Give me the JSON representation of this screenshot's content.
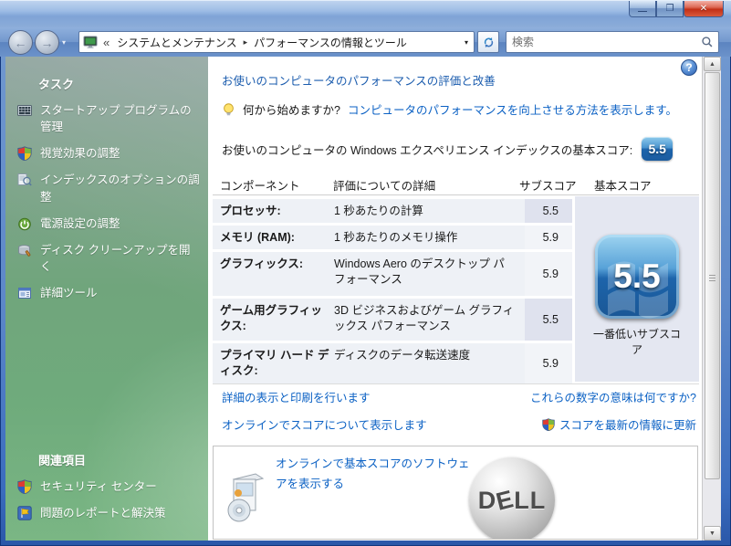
{
  "ui": {
    "glyphs": {
      "minimize": "—",
      "maximize": "❐",
      "close": "✕",
      "back": "←",
      "forward": "→",
      "dropdown": "▾",
      "crumb_separator": "▸",
      "help": "?",
      "scroll_up": "▲",
      "scroll_down": "▼"
    }
  },
  "toolbar": {
    "breadcrumb": {
      "chevrons": "«",
      "items": [
        "システムとメンテナンス",
        "パフォーマンスの情報とツール"
      ]
    },
    "search_placeholder": "検索"
  },
  "sidebar": {
    "tasks_header": "タスク",
    "tasks": [
      {
        "label": "スタートアップ プログラムの管理",
        "icon": "startup-programs-icon"
      },
      {
        "label": "視覚効果の調整",
        "icon": "uac-shield-icon"
      },
      {
        "label": "インデックスのオプションの調整",
        "icon": "indexing-options-icon"
      },
      {
        "label": "電源設定の調整",
        "icon": "power-settings-icon"
      },
      {
        "label": "ディスク クリーンアップを開く",
        "icon": "disk-cleanup-icon"
      },
      {
        "label": "詳細ツール",
        "icon": "advanced-tools-icon"
      }
    ],
    "related_header": "関連項目",
    "related": [
      {
        "label": "セキュリティ センター",
        "icon": "security-shield-icon"
      },
      {
        "label": "問題のレポートと解決策",
        "icon": "problem-reports-flag-icon"
      }
    ]
  },
  "main": {
    "title": "お使いのコンピュータのパフォーマンスの評価と改善",
    "hint_prefix": "何から始めますか?",
    "hint_link": "コンピュータのパフォーマンスを向上させる方法を表示します。",
    "base_score_label": "お使いのコンピュータの Windows エクスペリエンス インデックスの基本スコア:",
    "base_score_value": "5.5",
    "table": {
      "headers": [
        "コンポーネント",
        "評価についての詳細",
        "サブスコア",
        "基本スコア"
      ],
      "rows": [
        {
          "component": "プロセッサ:",
          "detail": "1 秒あたりの計算",
          "subscore": "5.5"
        },
        {
          "component": "メモリ (RAM):",
          "detail": "1 秒あたりのメモリ操作",
          "subscore": "5.9"
        },
        {
          "component": "グラフィックス:",
          "detail": "Windows Aero のデスクトップ パフォーマンス",
          "subscore": "5.9"
        },
        {
          "component": "ゲーム用グラフィックス:",
          "detail": "3D ビジネスおよびゲーム グラフィックス パフォーマンス",
          "subscore": "5.5"
        },
        {
          "component": "プライマリ ハード ディスク:",
          "detail": "ディスクのデータ転送速度",
          "subscore": "5.9"
        }
      ]
    },
    "badge": {
      "value": "5.5",
      "caption": "一番低いサブスコア"
    },
    "links": {
      "view_print": "詳細の表示と印刷を行います",
      "what_numbers": "これらの数字の意味は何ですか?",
      "online_scores": "オンラインでスコアについて表示します",
      "refresh_score": "スコアを最新の情報に更新"
    },
    "promo": {
      "link": "オンラインで基本スコアのソフトウェアを表示する",
      "brand_letters": [
        "D",
        "E",
        "L",
        "L"
      ]
    }
  },
  "colors": {
    "link_blue": "#0b61c4",
    "heading_blue": "#1b5cae",
    "badge_blue": "#1d64ab",
    "titlebar_blue": "#9dbce5",
    "sidebar_green_top": "#8ca19c",
    "sidebar_green_bottom": "#7ab684",
    "row_bg": "#eef1f6",
    "lowest_subscore_bg": "#dfe2ee",
    "base_score_panel_bg": "#e4e7f1"
  }
}
